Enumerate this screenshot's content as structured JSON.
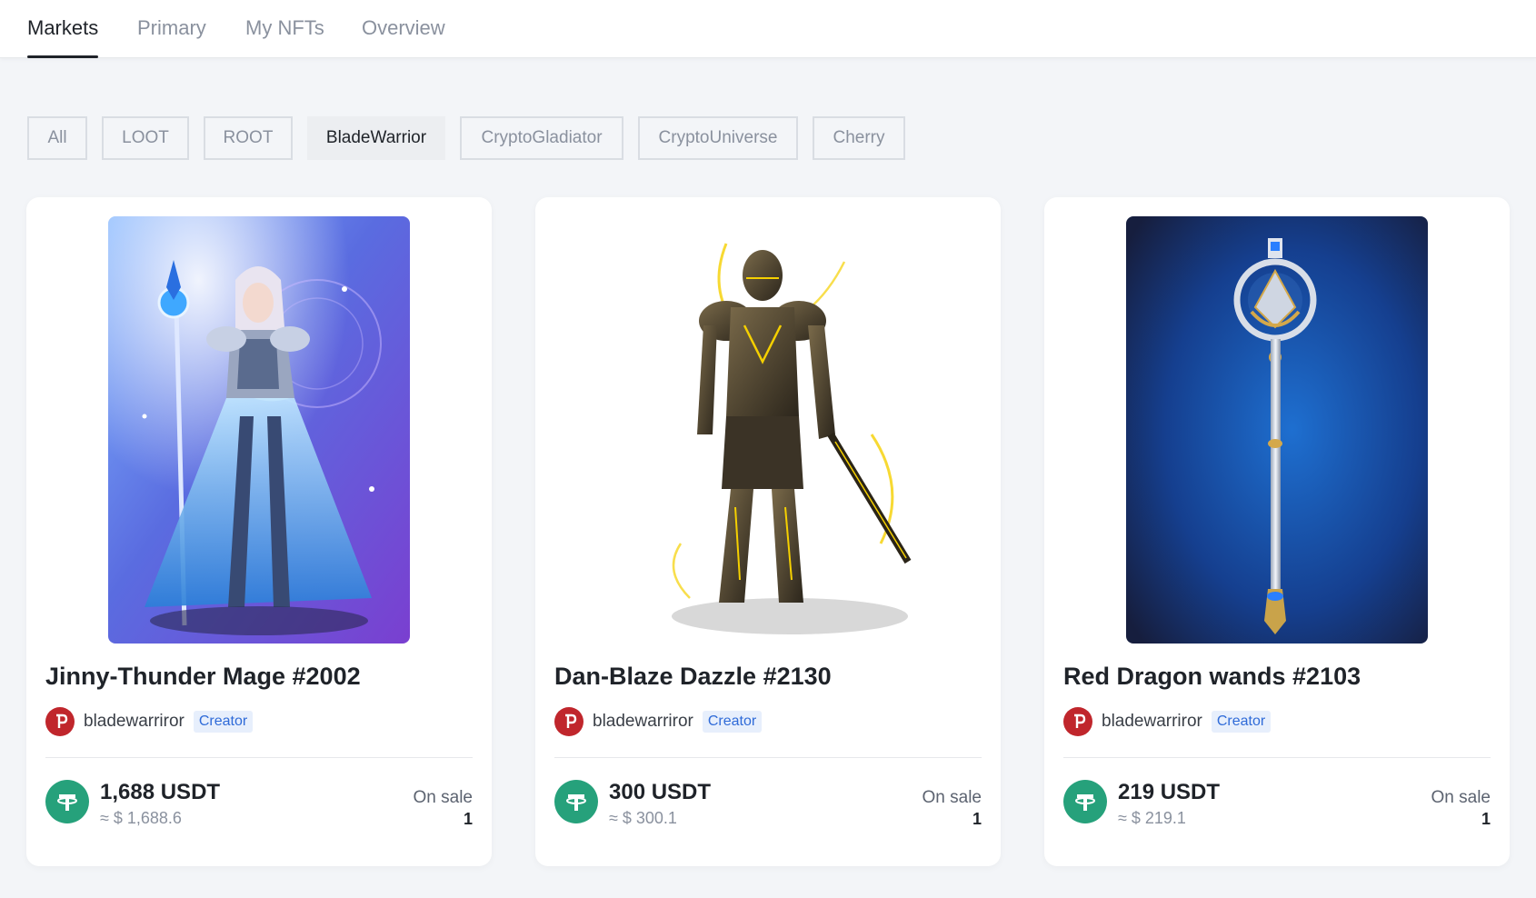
{
  "nav": {
    "tabs": [
      {
        "label": "Markets",
        "active": true
      },
      {
        "label": "Primary",
        "active": false
      },
      {
        "label": "My NFTs",
        "active": false
      },
      {
        "label": "Overview",
        "active": false
      }
    ]
  },
  "filters": {
    "options": [
      "All",
      "LOOT",
      "ROOT",
      "BladeWarrior",
      "CryptoGladiator",
      "CryptoUniverse",
      "Cherry"
    ],
    "selected": "BladeWarrior"
  },
  "cards": [
    {
      "title": "Jinny-Thunder Mage #2002",
      "creator": "bladewarriror",
      "creator_badge": "Creator",
      "price": "1,688 USDT",
      "price_usd": "≈ $ 1,688.6",
      "on_sale_label": "On sale",
      "on_sale_count": "1",
      "art": "mage-artwork"
    },
    {
      "title": "Dan-Blaze Dazzle #2130",
      "creator": "bladewarriror",
      "creator_badge": "Creator",
      "price": "300 USDT",
      "price_usd": "≈ $ 300.1",
      "on_sale_label": "On sale",
      "on_sale_count": "1",
      "art": "armored-knight-artwork"
    },
    {
      "title": "Red Dragon wands #2103",
      "creator": "bladewarriror",
      "creator_badge": "Creator",
      "price": "219 USDT",
      "price_usd": "≈ $ 219.1",
      "on_sale_label": "On sale",
      "on_sale_count": "1",
      "art": "wand-artwork"
    }
  ],
  "colors": {
    "background": "#f3f5f8",
    "usdt_green": "#26a17b",
    "creator_badge_blue": "#2f6bd8",
    "avatar_red": "#c0262c"
  },
  "icons": {
    "coin": "usdt-coin-icon",
    "avatar": "creator-avatar-icon"
  }
}
